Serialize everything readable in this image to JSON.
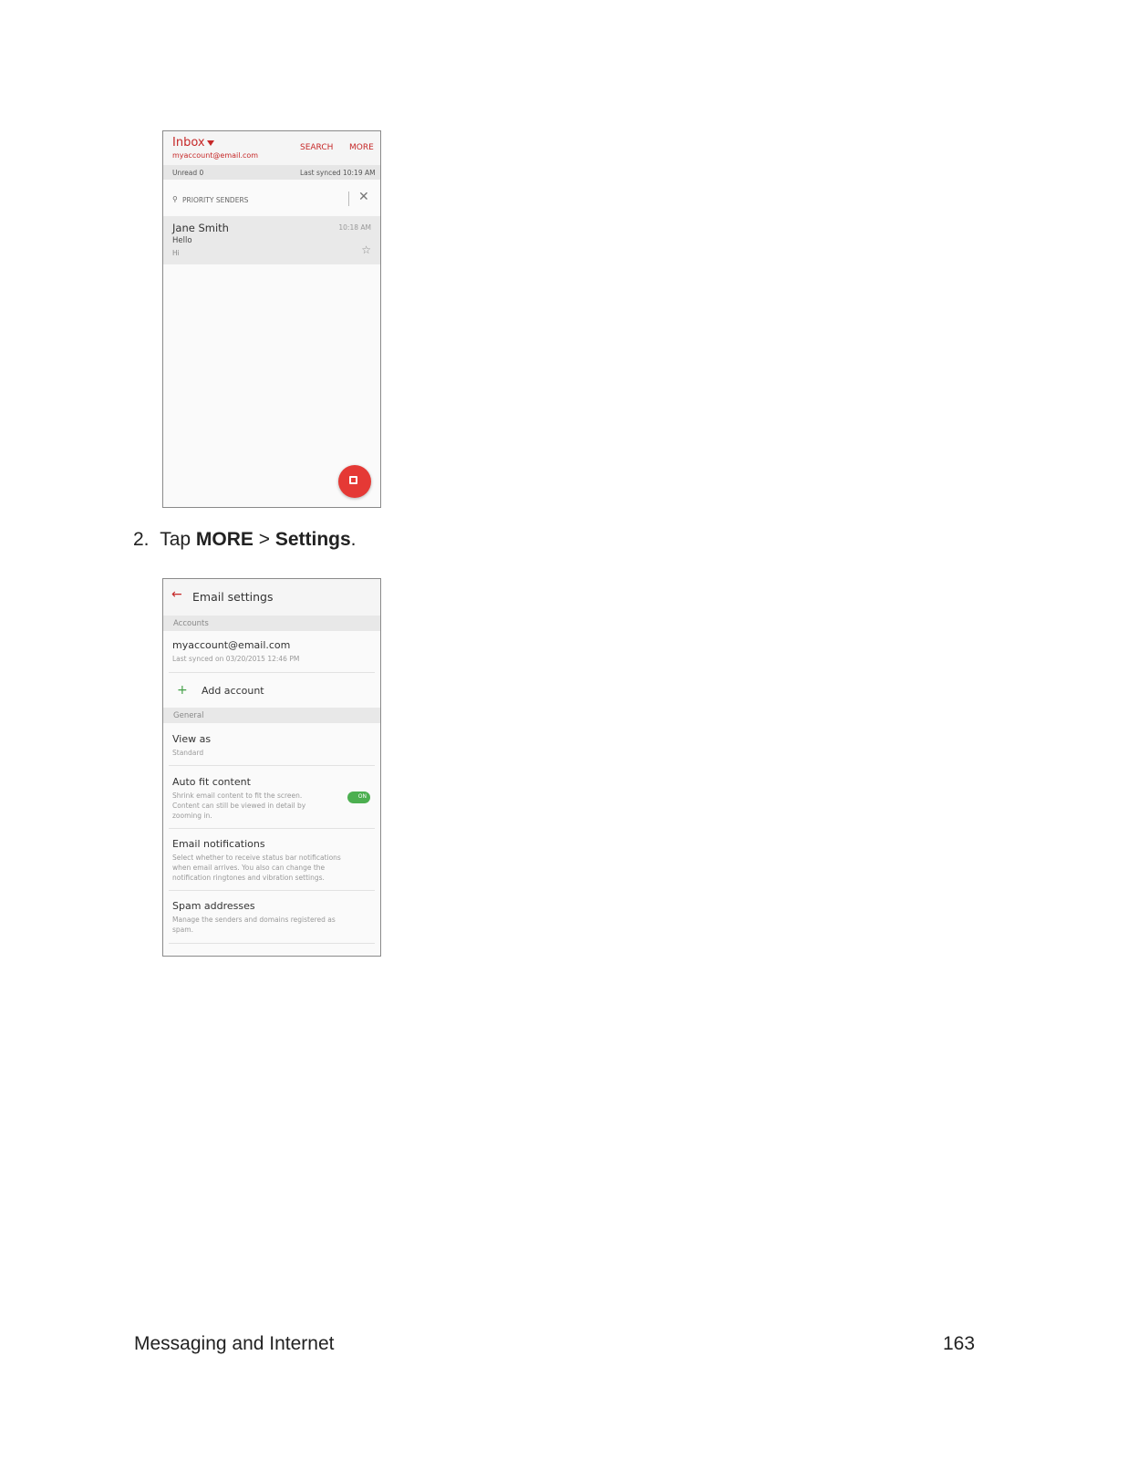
{
  "screenshot1": {
    "title": "Inbox",
    "account": "myaccount@email.com",
    "actions": [
      "SEARCH",
      "MORE"
    ],
    "unread": "Unread 0",
    "last_synced": "Last synced  10:19 AM",
    "priority_label": "PRIORITY SENDERS",
    "message": {
      "sender": "Jane Smith",
      "time": "10:18 AM",
      "subject": "Hello",
      "preview": "Hi"
    },
    "icons": [
      "caret-down-icon",
      "priority-icon",
      "close-icon",
      "star-icon",
      "compose-icon"
    ],
    "accent_color": "#e53935"
  },
  "step": {
    "number": "2.",
    "text_before": "Tap ",
    "menu": "MORE",
    "separator": " > ",
    "item": "Settings",
    "text_after": "."
  },
  "screenshot2": {
    "title": "Email settings",
    "sections": {
      "accounts": "Accounts",
      "general": "General"
    },
    "account": {
      "email": "myaccount@email.com",
      "synced": "Last synced on 03/20/2015 12:46 PM"
    },
    "add_account": "Add account",
    "items": [
      {
        "title": "View as",
        "sub": "Standard"
      },
      {
        "title": "Auto fit content",
        "sub": "Shrink email content to fit the screen. Content can still be viewed in detail by zooming in.",
        "toggle": "ON"
      },
      {
        "title": "Email notifications",
        "sub": "Select whether to receive status bar notifications when email arrives. You also can change the notification ringtones and vibration settings."
      },
      {
        "title": "Spam addresses",
        "sub": "Manage the senders and domains registered as spam."
      }
    ],
    "icons": [
      "back-arrow-icon",
      "plus-icon",
      "toggle-switch"
    ],
    "toggle_color": "#4caf50"
  },
  "footer": {
    "section": "Messaging and Internet",
    "page": "163"
  }
}
